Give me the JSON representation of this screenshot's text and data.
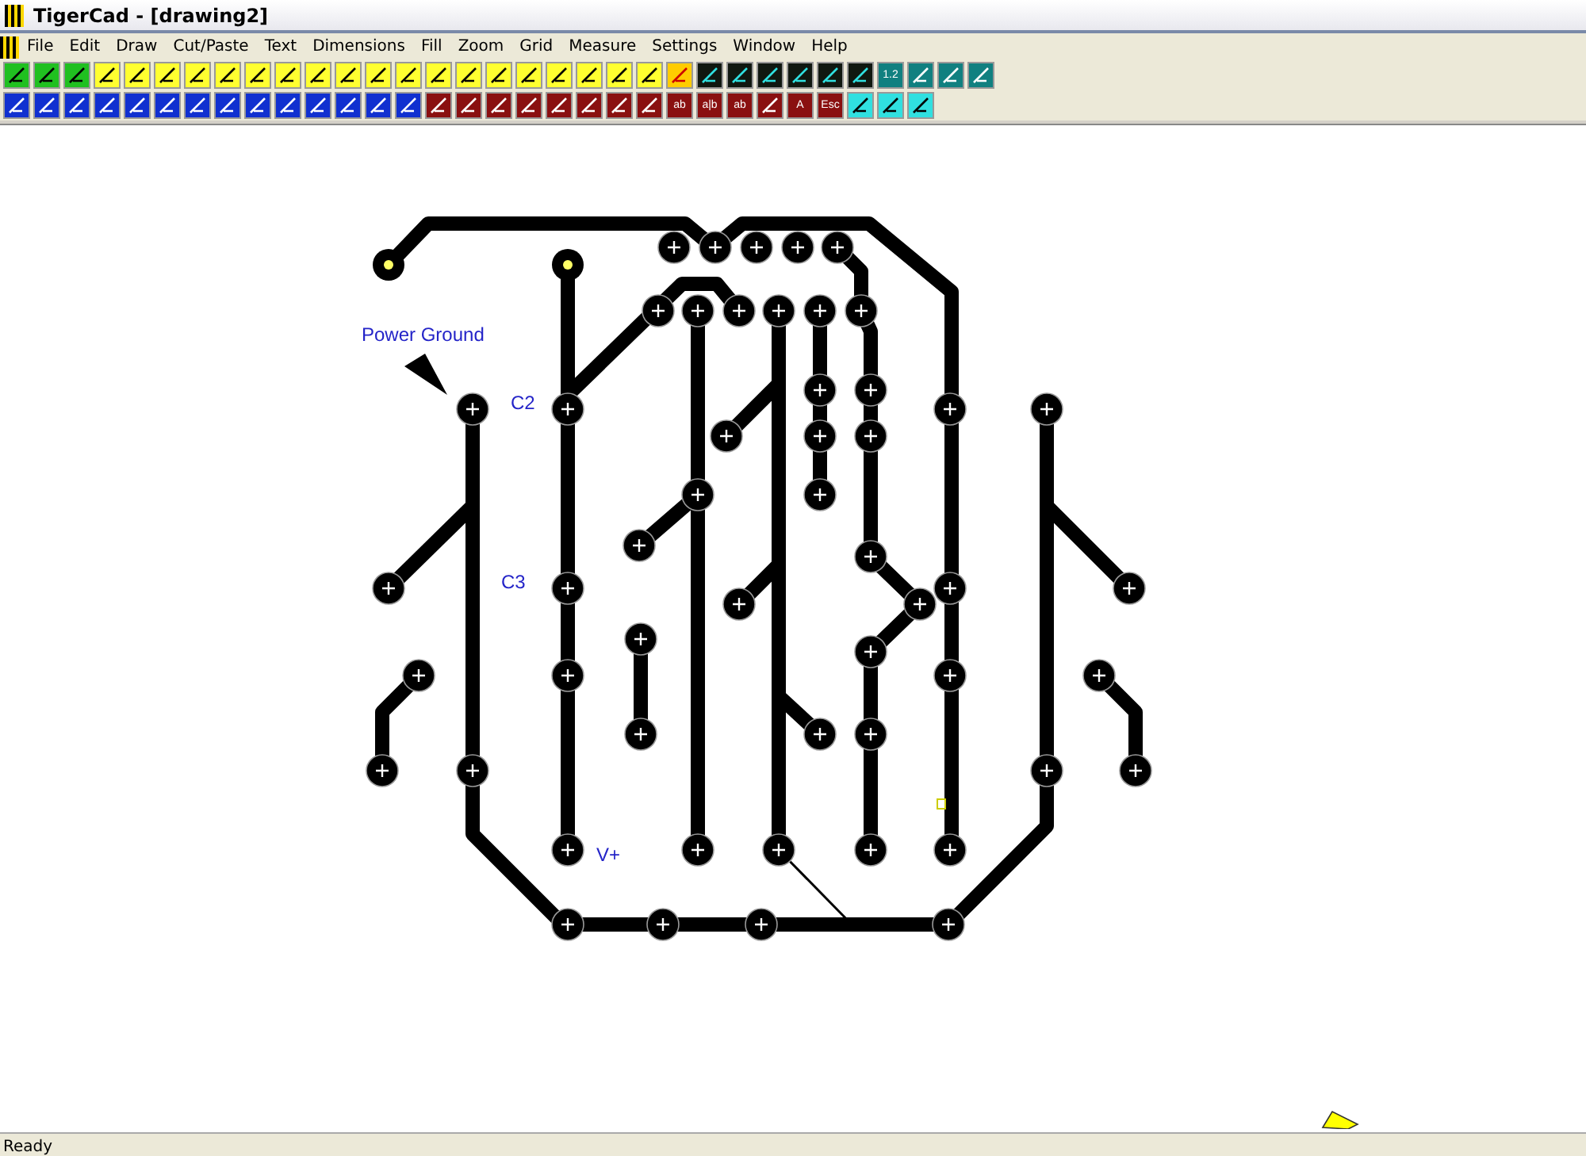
{
  "window": {
    "title": "TigerCad - [drawing2]"
  },
  "menu": [
    "File",
    "Edit",
    "Draw",
    "Cut/Paste",
    "Text",
    "Dimensions",
    "Fill",
    "Zoom",
    "Grid",
    "Measure",
    "Settings",
    "Window",
    "Help"
  ],
  "toolbars": [
    [
      {
        "kind": "green"
      },
      {
        "kind": "green"
      },
      {
        "kind": "green"
      },
      {
        "kind": "yellow"
      },
      {
        "kind": "yellow"
      },
      {
        "kind": "yellow"
      },
      {
        "kind": "yellow"
      },
      {
        "kind": "yellow"
      },
      {
        "kind": "yellow"
      },
      {
        "kind": "yellow"
      },
      {
        "kind": "yellow"
      },
      {
        "kind": "yellow"
      },
      {
        "kind": "yellow"
      },
      {
        "kind": "yellow"
      },
      {
        "kind": "yellow"
      },
      {
        "kind": "yellow"
      },
      {
        "kind": "yellow"
      },
      {
        "kind": "yellow"
      },
      {
        "kind": "yellow"
      },
      {
        "kind": "yellow"
      },
      {
        "kind": "yellow"
      },
      {
        "kind": "yellow"
      },
      {
        "kind": "stripes"
      },
      {
        "kind": "dark"
      },
      {
        "kind": "dark"
      },
      {
        "kind": "dark"
      },
      {
        "kind": "dark"
      },
      {
        "kind": "dark"
      },
      {
        "kind": "dark"
      },
      {
        "kind": "teal",
        "label": "1.2"
      },
      {
        "kind": "teal"
      },
      {
        "kind": "teal"
      },
      {
        "kind": "teal"
      }
    ],
    [
      {
        "kind": "blue"
      },
      {
        "kind": "blue"
      },
      {
        "kind": "blue"
      },
      {
        "kind": "blue"
      },
      {
        "kind": "blue"
      },
      {
        "kind": "blue"
      },
      {
        "kind": "blue"
      },
      {
        "kind": "blue"
      },
      {
        "kind": "blue"
      },
      {
        "kind": "blue"
      },
      {
        "kind": "blue"
      },
      {
        "kind": "blue"
      },
      {
        "kind": "blue"
      },
      {
        "kind": "blue"
      },
      {
        "kind": "maroon"
      },
      {
        "kind": "maroon"
      },
      {
        "kind": "maroon"
      },
      {
        "kind": "maroon"
      },
      {
        "kind": "maroon"
      },
      {
        "kind": "maroon"
      },
      {
        "kind": "maroon"
      },
      {
        "kind": "maroon"
      },
      {
        "kind": "maroon",
        "label": "ab"
      },
      {
        "kind": "maroon",
        "label": "a|b"
      },
      {
        "kind": "maroon",
        "label": "ab"
      },
      {
        "kind": "maroon"
      },
      {
        "kind": "maroon",
        "label": "A"
      },
      {
        "kind": "maroon",
        "label": "Esc"
      },
      {
        "kind": "aqua"
      },
      {
        "kind": "aqua"
      },
      {
        "kind": "aqua"
      }
    ]
  ],
  "canvas": {
    "labels": [
      "Power Ground",
      "C2",
      "C3",
      "V+"
    ]
  },
  "status_bar": "Ready"
}
